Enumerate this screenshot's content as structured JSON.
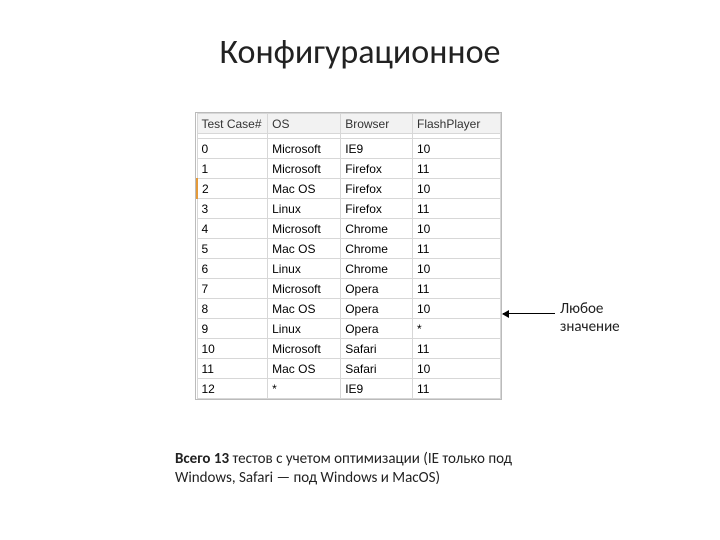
{
  "title": "Конфигурационное",
  "table": {
    "headers": [
      "Test Case#",
      "OS",
      "Browser",
      "FlashPlayer"
    ],
    "rows": [
      {
        "tc": "0",
        "os": "Microsoft",
        "browser": "IE9",
        "fp": "10",
        "hl": false
      },
      {
        "tc": "1",
        "os": "Microsoft",
        "browser": "Firefox",
        "fp": "11",
        "hl": false
      },
      {
        "tc": "2",
        "os": "Mac OS",
        "browser": "Firefox",
        "fp": "10",
        "hl": true
      },
      {
        "tc": "3",
        "os": "Linux",
        "browser": "Firefox",
        "fp": "11",
        "hl": false
      },
      {
        "tc": "4",
        "os": "Microsoft",
        "browser": "Chrome",
        "fp": "10",
        "hl": false
      },
      {
        "tc": "5",
        "os": "Mac OS",
        "browser": "Chrome",
        "fp": "11",
        "hl": false
      },
      {
        "tc": "6",
        "os": "Linux",
        "browser": "Chrome",
        "fp": "10",
        "hl": false
      },
      {
        "tc": "7",
        "os": "Microsoft",
        "browser": "Opera",
        "fp": "11",
        "hl": false
      },
      {
        "tc": "8",
        "os": "Mac OS",
        "browser": "Opera",
        "fp": "10",
        "hl": false
      },
      {
        "tc": "9",
        "os": "Linux",
        "browser": "Opera",
        "fp": "*",
        "hl": false
      },
      {
        "tc": "10",
        "os": "Microsoft",
        "browser": "Safari",
        "fp": "11",
        "hl": false
      },
      {
        "tc": "11",
        "os": "Mac OS",
        "browser": "Safari",
        "fp": "10",
        "hl": false
      },
      {
        "tc": "12",
        "os": "*",
        "browser": "IE9",
        "fp": "11",
        "hl": false
      }
    ]
  },
  "annotation": {
    "line1": "Любое",
    "line2": "значение"
  },
  "footer": {
    "bold": "Всего 13",
    "rest": " тестов с учетом оптимизации (IE только под Windows, Safari — под Windows и MacOS)"
  }
}
